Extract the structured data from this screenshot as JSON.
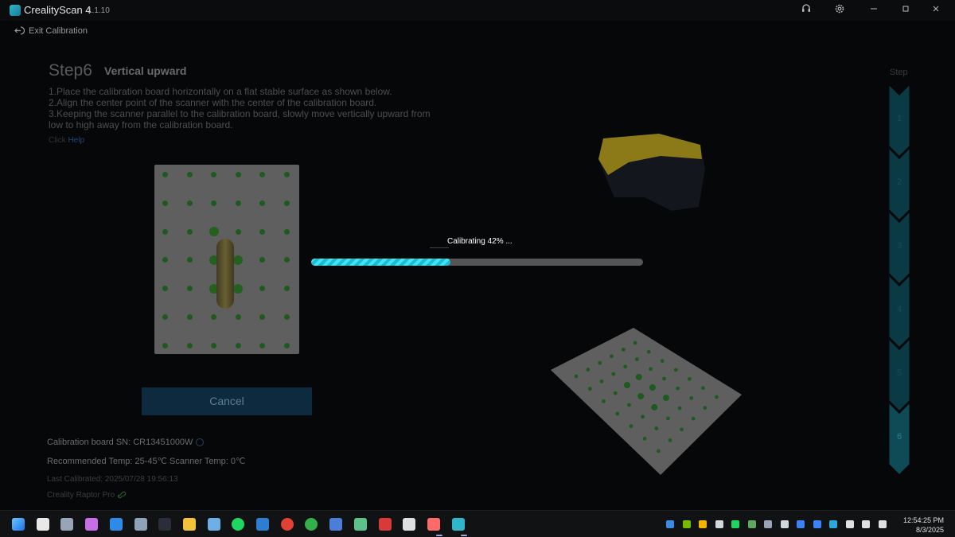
{
  "app": {
    "name": "CrealityScan 4",
    "version": "1.1.10"
  },
  "nav": {
    "exit_label": "Exit Calibration"
  },
  "step": {
    "number": "Step6",
    "title": "Vertical upward",
    "instructions": [
      "1.Place the calibration board horizontally on a flat stable surface as shown below.",
      "2.Align the center point of the scanner with the center of the calibration board.",
      "3.Keeping the scanner parallel to the calibration board, slowly move vertically upward from",
      "low to high away from the calibration board."
    ],
    "click_prefix": "Click ",
    "help_link": "Help"
  },
  "progress": {
    "label": "Calibrating 42% ...",
    "percent": 42
  },
  "cancel_label": "Cancel",
  "info": {
    "board_sn": "Calibration board SN: CR13451000W",
    "temps": "Recommended Temp: 25-45℃ Scanner Temp: 0℃",
    "last_calibrated": "Last Calibrated: 2025/07/28 19:56:13",
    "device": "Creality Raptor Pro"
  },
  "steps_panel": {
    "label": "Step",
    "steps": [
      "1",
      "2",
      "3",
      "4",
      "5",
      "6"
    ],
    "current": 6
  },
  "colors": {
    "accent": "#2fd6ec",
    "board_dot": "#1e5a1e",
    "cancel_bg": "#0d2a3f"
  },
  "taskbar": {
    "apps": [
      "windows-start",
      "file-explorer",
      "settings",
      "copilot",
      "microsoft-store",
      "calculator",
      "speed-gauge",
      "folder",
      "notepad",
      "spotify",
      "qbittorrent",
      "chrome",
      "xbox",
      "teams",
      "color-picker",
      "game-launcher",
      "video-app",
      "snipping-tool",
      "crealityscan"
    ],
    "tray": [
      "defender",
      "nvidia",
      "google-drive",
      "onedrive",
      "spotify-tray",
      "greenshot",
      "security",
      "chat",
      "dropbox",
      "bluetooth",
      "vpn",
      "wifi",
      "volume",
      "battery"
    ],
    "time": "12:54:25 PM",
    "date": "8/3/2025"
  }
}
